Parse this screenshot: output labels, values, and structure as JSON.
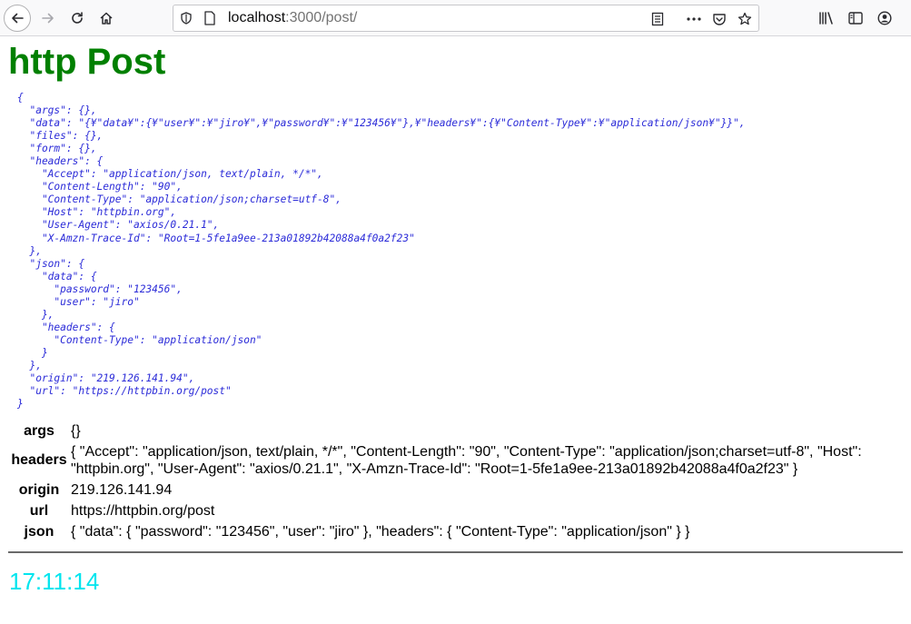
{
  "browser": {
    "url_host": "localhost",
    "url_rest": ":3000/post/"
  },
  "page": {
    "title": "http Post",
    "json_dump": "{\n  \"args\": {},\n  \"data\": \"{¥\"data¥\":{¥\"user¥\":¥\"jiro¥\",¥\"password¥\":¥\"123456¥\"},¥\"headers¥\":{¥\"Content-Type¥\":¥\"application/json¥\"}}\",\n  \"files\": {},\n  \"form\": {},\n  \"headers\": {\n    \"Accept\": \"application/json, text/plain, */*\",\n    \"Content-Length\": \"90\",\n    \"Content-Type\": \"application/json;charset=utf-8\",\n    \"Host\": \"httpbin.org\",\n    \"User-Agent\": \"axios/0.21.1\",\n    \"X-Amzn-Trace-Id\": \"Root=1-5fe1a9ee-213a01892b42088a4f0a2f23\"\n  },\n  \"json\": {\n    \"data\": {\n      \"password\": \"123456\",\n      \"user\": \"jiro\"\n    },\n    \"headers\": {\n      \"Content-Type\": \"application/json\"\n    }\n  },\n  \"origin\": \"219.126.141.94\",\n  \"url\": \"https://httpbin.org/post\"\n}",
    "table": {
      "args_label": "args",
      "args_value": "{}",
      "headers_label": "headers",
      "headers_value": "{ \"Accept\": \"application/json, text/plain, */*\", \"Content-Length\": \"90\", \"Content-Type\": \"application/json;charset=utf-8\", \"Host\": \"httpbin.org\", \"User-Agent\": \"axios/0.21.1\", \"X-Amzn-Trace-Id\": \"Root=1-5fe1a9ee-213a01892b42088a4f0a2f23\" }",
      "origin_label": "origin",
      "origin_value": "219.126.141.94",
      "url_label": "url",
      "url_value": "https://httpbin.org/post",
      "json_label": "json",
      "json_value": "{ \"data\": { \"password\": \"123456\", \"user\": \"jiro\" }, \"headers\": { \"Content-Type\": \"application/json\" } }"
    },
    "clock": "17:11:14"
  },
  "colors": {
    "title": "#008000",
    "json_text": "#2b2bd8",
    "clock": "#00e5ee"
  },
  "icons": [
    "back-arrow-icon",
    "forward-arrow-icon",
    "reload-icon",
    "home-icon",
    "shield-icon",
    "page-icon",
    "reader-view-icon",
    "more-icon",
    "pocket-icon",
    "bookmark-star-icon",
    "library-icon",
    "sidebar-icon",
    "account-icon"
  ]
}
